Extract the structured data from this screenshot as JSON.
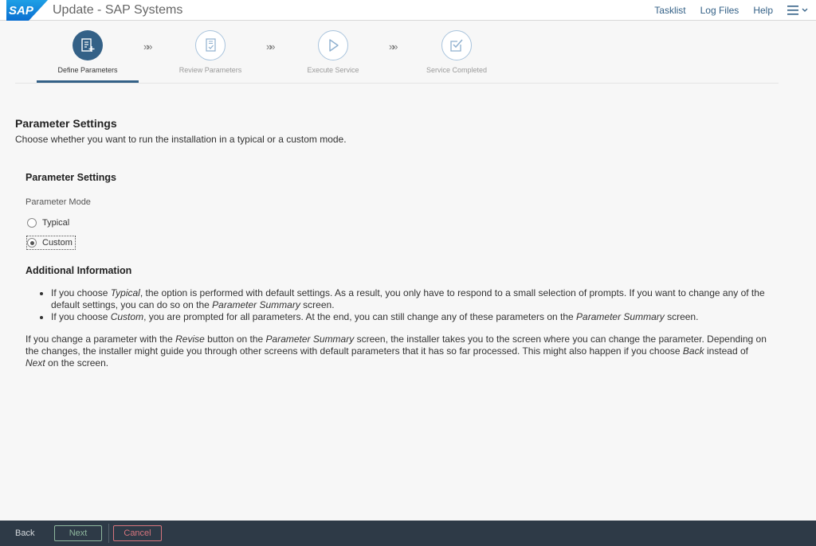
{
  "header": {
    "logo_text": "SAP",
    "title": "Update - SAP Systems",
    "links": {
      "tasklist": "Tasklist",
      "log_files": "Log Files",
      "help": "Help"
    },
    "menu_icon": "hamburger-menu-icon"
  },
  "wizard": {
    "steps": [
      {
        "label": "Define Parameters",
        "icon": "document-edit-icon",
        "state": "active"
      },
      {
        "label": "Review Parameters",
        "icon": "document-check-icon",
        "state": "inactive"
      },
      {
        "label": "Execute Service",
        "icon": "play-icon",
        "state": "inactive"
      },
      {
        "label": "Service Completed",
        "icon": "checkbox-tick-icon",
        "state": "inactive"
      }
    ],
    "separator": "»»"
  },
  "main": {
    "title": "Parameter Settings",
    "description": "Choose whether you want to run the installation in a typical or a custom mode.",
    "section_title": "Parameter Settings",
    "field_label": "Parameter Mode",
    "options": [
      {
        "label": "Typical",
        "selected": false
      },
      {
        "label": "Custom",
        "selected": true
      }
    ],
    "info_title": "Additional Information",
    "bullets": {
      "b1_prefix": "If you choose ",
      "b1_em1": "Typical",
      "b1_mid": ", the option is performed with default settings. As a result, you only have to respond to a small selection of prompts. If you want to change any of the default settings, you can do so on the ",
      "b1_em2": "Parameter Summary",
      "b1_suffix": " screen.",
      "b2_prefix": "If you choose ",
      "b2_em1": "Custom",
      "b2_mid": ", you are prompted for all parameters. At the end, you can still change any of these parameters on the ",
      "b2_em2": "Parameter Summary",
      "b2_suffix": " screen."
    },
    "para": {
      "p1": "If you change a parameter with the ",
      "em1": "Revise",
      "p2": " button on the ",
      "em2": "Parameter Summary",
      "p3": " screen, the installer takes you to the screen where you can change the parameter. Depending on the changes, the installer might guide you through other screens with default parameters that it has so far processed. This might also happen if you choose ",
      "em3": "Back",
      "p4": " instead of ",
      "em4": "Next",
      "p5": " on the screen."
    }
  },
  "footer": {
    "back": "Back",
    "next": "Next",
    "cancel": "Cancel"
  },
  "colors": {
    "accent": "#346187",
    "footer_bg": "#2e3a47",
    "next": "#8fb79e",
    "cancel": "#d7757d"
  }
}
